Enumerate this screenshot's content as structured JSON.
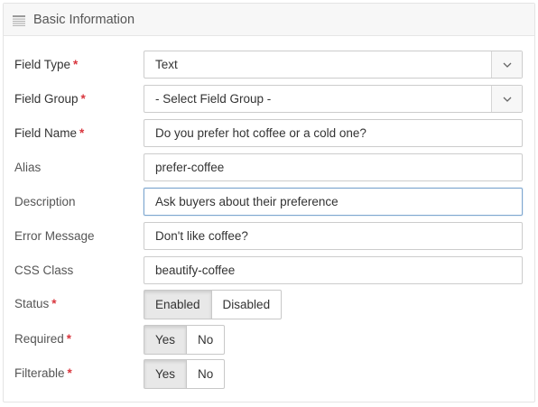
{
  "panel": {
    "title": "Basic Information",
    "icon": "list-icon"
  },
  "fields": {
    "field_type": {
      "label": "Field Type",
      "required": "*",
      "value": "Text"
    },
    "field_group": {
      "label": "Field Group",
      "required": "*",
      "value": "- Select Field Group -"
    },
    "field_name": {
      "label": "Field Name",
      "required": "*",
      "value": "Do you prefer hot coffee or a cold one?"
    },
    "alias": {
      "label": "Alias",
      "value": "prefer-coffee"
    },
    "description": {
      "label": "Description",
      "value": "Ask buyers about their preference"
    },
    "error_message": {
      "label": "Error Message",
      "value": "Don't like coffee?"
    },
    "css_class": {
      "label": "CSS Class",
      "value": "beautify-coffee"
    },
    "status": {
      "label": "Status",
      "required": "*",
      "options": [
        "Enabled",
        "Disabled"
      ],
      "selected": "Enabled"
    },
    "required": {
      "label": "Required",
      "required": "*",
      "options": [
        "Yes",
        "No"
      ],
      "selected": "Yes"
    },
    "filterable": {
      "label": "Filterable",
      "required": "*",
      "options": [
        "Yes",
        "No"
      ],
      "selected": "Yes"
    }
  },
  "colors": {
    "required_marker": "#d9363e",
    "focus_border": "#7fa7d0",
    "active_button": "#e8e8e8"
  }
}
